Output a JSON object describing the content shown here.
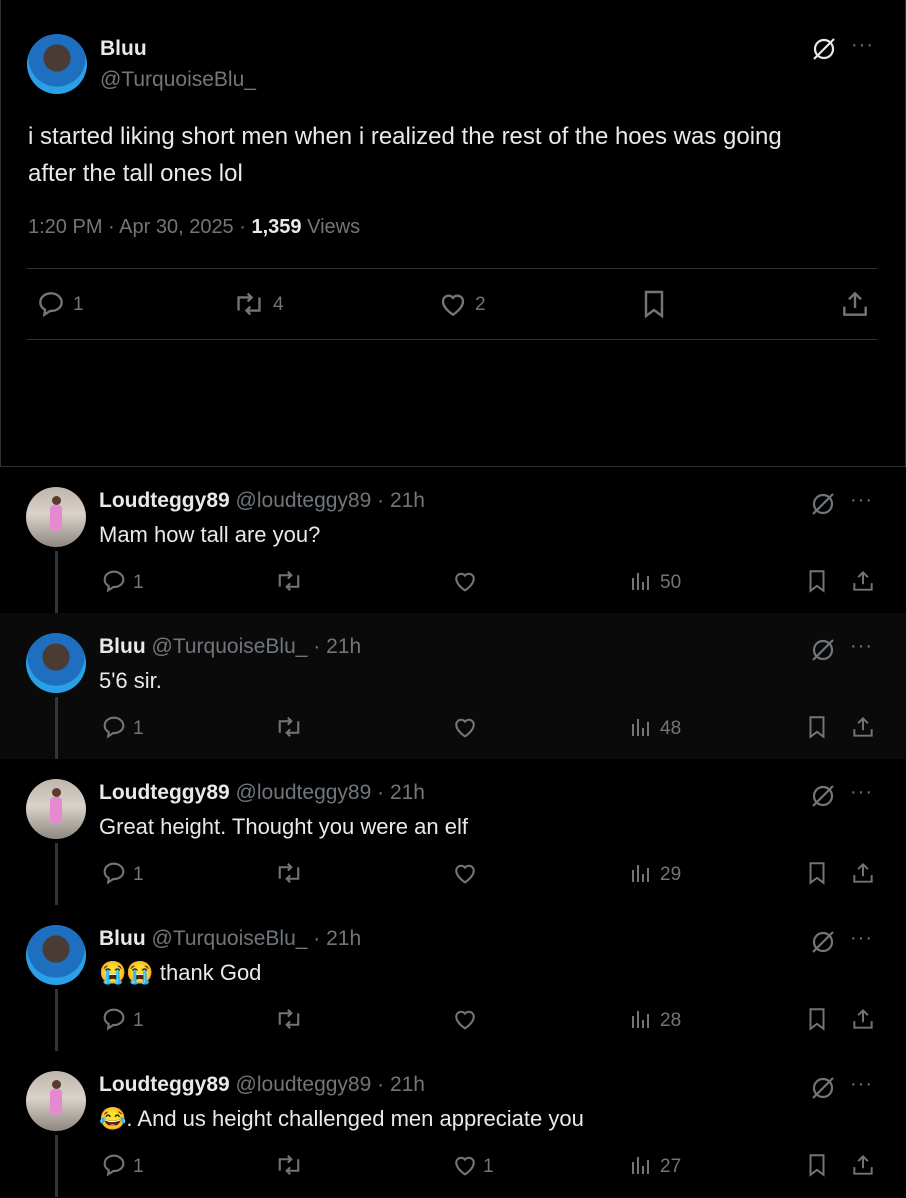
{
  "main": {
    "name": "Bluu",
    "handle": "@TurquoiseBlu_",
    "text_line1": "i started liking short men when i realized the rest of the hoes was going",
    "text_line2": "after the tall ones lol",
    "time": "1:20 PM · Apr 30, 2025 · ",
    "views_count": "1,359",
    "views_label": " Views",
    "replies": "1",
    "reposts": "4",
    "likes": "2"
  },
  "replies": [
    {
      "name": "Loudteggy89",
      "handle": "@loudteggy89 · 21h",
      "text": "Mam how tall are you?",
      "replies": "1",
      "reposts": "",
      "likes": "",
      "views": "50",
      "highlight": false,
      "avatar": "loud"
    },
    {
      "name": "Bluu",
      "handle": "@TurquoiseBlu_ · 21h",
      "text": "5'6 sir.",
      "replies": "1",
      "reposts": "",
      "likes": "",
      "views": "48",
      "highlight": true,
      "avatar": "bluu"
    },
    {
      "name": "Loudteggy89",
      "handle": "@loudteggy89 · 21h",
      "text": "Great height. Thought you were an elf",
      "replies": "1",
      "reposts": "",
      "likes": "",
      "views": "29",
      "highlight": false,
      "avatar": "loud"
    },
    {
      "name": "Bluu",
      "handle": "@TurquoiseBlu_ · 21h",
      "text": "😭😭 thank God",
      "replies": "1",
      "reposts": "",
      "likes": "",
      "views": "28",
      "highlight": false,
      "avatar": "bluu"
    },
    {
      "name": "Loudteggy89",
      "handle": "@loudteggy89 · 21h",
      "text": "😂. And us height challenged men appreciate you",
      "replies": "1",
      "reposts": "",
      "likes": "1",
      "views": "27",
      "highlight": false,
      "avatar": "loud"
    }
  ],
  "icons": {
    "grok": "grok-icon",
    "more": "more-icon",
    "reply": "reply-icon",
    "repost": "repost-icon",
    "like": "like-icon",
    "bookmark": "bookmark-icon",
    "share": "share-icon",
    "views": "views-icon"
  }
}
